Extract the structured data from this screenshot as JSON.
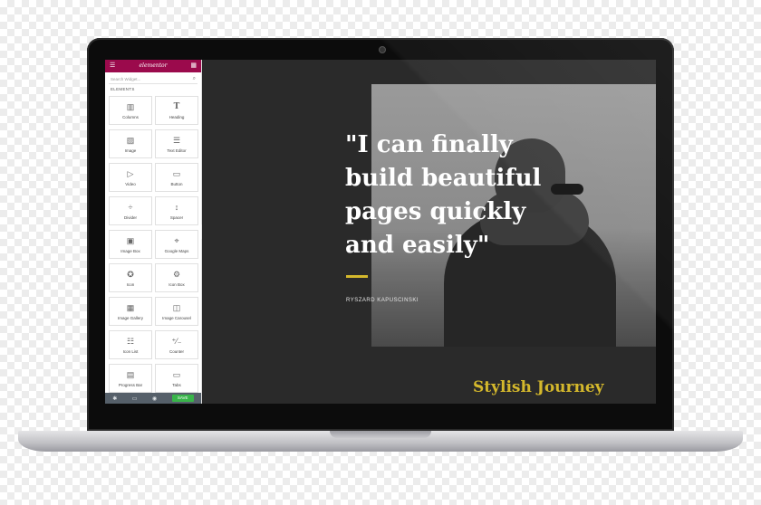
{
  "editor": {
    "logo": "elementor",
    "search_placeholder": "Search Widget...",
    "section_label": "ELEMENTS",
    "widgets": [
      {
        "label": "Columns",
        "icon": "columns-icon"
      },
      {
        "label": "Heading",
        "icon": "heading-icon"
      },
      {
        "label": "Image",
        "icon": "image-icon"
      },
      {
        "label": "Text Editor",
        "icon": "text-editor-icon"
      },
      {
        "label": "Video",
        "icon": "video-icon"
      },
      {
        "label": "Button",
        "icon": "button-icon"
      },
      {
        "label": "Divider",
        "icon": "divider-icon"
      },
      {
        "label": "Spacer",
        "icon": "spacer-icon"
      },
      {
        "label": "Image Box",
        "icon": "image-box-icon"
      },
      {
        "label": "Google Maps",
        "icon": "google-maps-icon"
      },
      {
        "label": "Icon",
        "icon": "star-icon"
      },
      {
        "label": "Icon Box",
        "icon": "icon-box-icon"
      },
      {
        "label": "Image Gallery",
        "icon": "gallery-icon"
      },
      {
        "label": "Image Carousel",
        "icon": "carousel-icon"
      },
      {
        "label": "Icon List",
        "icon": "list-icon"
      },
      {
        "label": "Counter",
        "icon": "counter-icon"
      },
      {
        "label": "Progress Bar",
        "icon": "progress-bar-icon"
      },
      {
        "label": "Tabs",
        "icon": "tabs-icon"
      }
    ],
    "save_label": "SAVE"
  },
  "page": {
    "quote": "\"I can finally\nbuild beautiful\npages quickly\nand easily\"",
    "author": "RYSZARD KAPUSCINSKI",
    "site_title": "Stylish Journey"
  },
  "colors": {
    "brand": "#9b0a4c",
    "accent": "#d4b82c",
    "save": "#39b54a",
    "canvas": "#2a2a2a"
  }
}
